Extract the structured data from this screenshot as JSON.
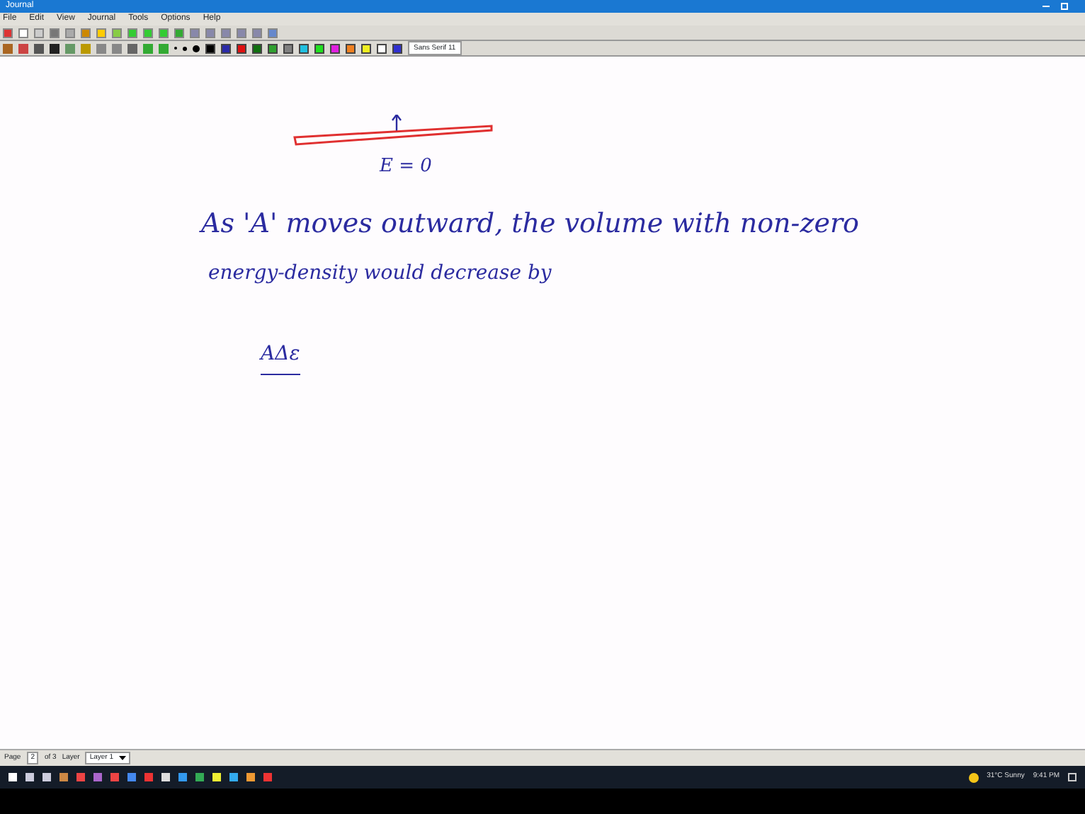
{
  "window": {
    "title": "Journal"
  },
  "menu": [
    "File",
    "Edit",
    "View",
    "Journal",
    "Tools",
    "Options",
    "Help"
  ],
  "pen_colors": [
    {
      "color": "#000000"
    },
    {
      "color": "#2a2aa8"
    },
    {
      "color": "#e01010"
    },
    {
      "color": "#107010"
    },
    {
      "color": "#30a030"
    },
    {
      "color": "#808080"
    },
    {
      "color": "#20c0e0"
    },
    {
      "color": "#20e020"
    },
    {
      "color": "#e020e0"
    },
    {
      "color": "#f08020"
    },
    {
      "color": "#f0f020"
    },
    {
      "color": "#ffffff"
    },
    {
      "color": "#3030d0"
    }
  ],
  "font_box": {
    "family": "Sans Serif",
    "size": "11"
  },
  "note": {
    "label": "E = 0",
    "lines": [
      "As 'A' moves outward, the volume with non-zero",
      "energy-density would decrease by"
    ],
    "term": "AΔε"
  },
  "status_bar": {
    "page_label": "Page",
    "page": "2",
    "of": "of 3",
    "layer_label": "Layer",
    "layer": "Layer 1"
  },
  "tray": {
    "weather": "31°C Sunny",
    "time": "9:41 PM"
  }
}
